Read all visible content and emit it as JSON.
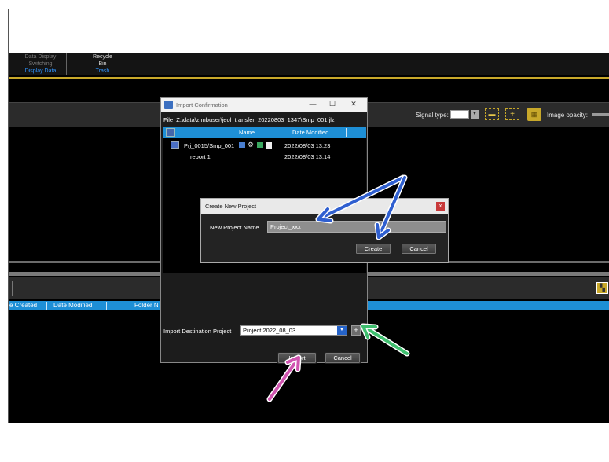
{
  "ribbon": {
    "group1": {
      "line1": "Data Display",
      "line2": "Switching",
      "tab": "Display Data"
    },
    "group2": {
      "line1": "Recycle",
      "line2": "Bin",
      "tab": "Trash"
    }
  },
  "toolbar": {
    "signal_type_label": "Signal type:",
    "image_opacity_label": "Image opacity:"
  },
  "table": {
    "headers": [
      "e Created",
      "Date Modified",
      "Folder N"
    ]
  },
  "import_dialog": {
    "title": "Import Confirmation",
    "file_label": "File",
    "file_path": "Z:\\data\\z.mbuser\\jeol_transfer_20220803_1347\\Smp_001.jlz",
    "columns": {
      "name": "Name",
      "date_modified": "Date Modified"
    },
    "rows": [
      {
        "name": "Prj_0015/Smp_001",
        "date": "2022/08/03 13:23"
      },
      {
        "name": "report 1",
        "date": "2022/08/03 13:14"
      }
    ],
    "destination_label": "Import Destination Project",
    "destination_value": "Project 2022_08_03",
    "plus_label": "+",
    "import_label": "Import",
    "cancel_label": "Cancel"
  },
  "create_dialog": {
    "title": "Create New Project",
    "close_label": "x",
    "name_label": "New Project Name",
    "name_value": "Project_xxx",
    "create_label": "Create",
    "cancel_label": "Cancel"
  },
  "colors": {
    "header_blue": "#1e8fd6",
    "accent_gold": "#c8a82a",
    "arrow_blue": "#2f5fd0",
    "arrow_green": "#3fbf6f",
    "arrow_pink": "#d055b0"
  },
  "icons": [
    "app-icon",
    "minimize-icon",
    "maximize-icon",
    "close-icon",
    "folder-icon",
    "map-icon",
    "gear-icon",
    "image-icon",
    "document-icon",
    "dropdown-arrow-icon",
    "grid-icon"
  ]
}
